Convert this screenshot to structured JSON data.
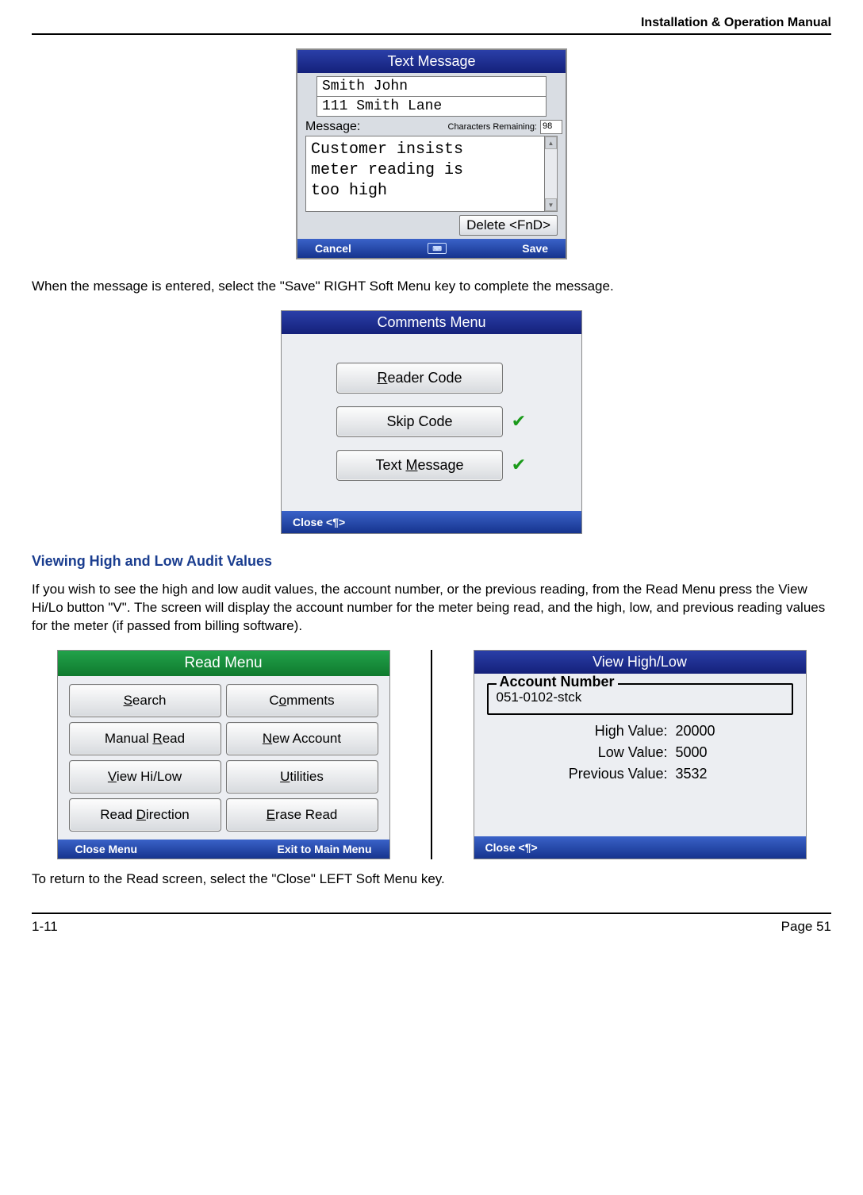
{
  "header": {
    "title": "Installation & Operation Manual"
  },
  "textMessage": {
    "title": "Text Message",
    "name": "Smith John",
    "address": "111 Smith Lane",
    "messageLabel": "Message:",
    "charsLabel": "Characters Remaining:",
    "charsRemaining": "98",
    "body": "Customer insists\nmeter reading is\ntoo high",
    "deleteLabel": "Delete <FnD>",
    "cancelLabel": "Cancel",
    "saveLabel": "Save"
  },
  "para1": "When the message is entered,  select the \"Save\" RIGHT Soft Menu key to complete the message.",
  "commentsMenu": {
    "title": "Comments Menu",
    "readerLabel": "Reader Code",
    "readerMnemonic": "R",
    "skipLabel": "Skip Code",
    "textLabel": "Text Message",
    "textMnemonic": "M",
    "closeLabel": "Close <¶>"
  },
  "section2": {
    "title": "Viewing High and Low Audit Values",
    "para": "If you wish to see the high and low audit values, the account number, or the previous reading, from the Read Menu press the View Hi/Lo button \"V\".  The screen will display the account number for the meter being read, and the high, low, and previous reading values for the meter (if passed from billing software)."
  },
  "readMenu": {
    "title": "Read Menu",
    "buttons": {
      "search": "Search",
      "searchM": "S",
      "comments": "Comments",
      "commentsM": "o",
      "manual": "Manual Read",
      "manualM": "R",
      "newacct": "New Account",
      "newacctM": "N",
      "viewhl": "View Hi/Low",
      "viewhlM": "V",
      "util": "Utilities",
      "utilM": "U",
      "readdir": "Read Direction",
      "readdirM": "D",
      "erase": "Erase Read",
      "eraseM": "E"
    },
    "closeLabel": "Close Menu",
    "exitLabel": "Exit to Main Menu"
  },
  "viewHL": {
    "title": "View High/Low",
    "legend": "Account Number",
    "account": "051-0102-stck",
    "highLabel": "High Value:",
    "highVal": "20000",
    "lowLabel": "Low Value:",
    "lowVal": "5000",
    "prevLabel": "Previous Value:",
    "prevVal": "3532",
    "closeLabel": "Close <¶>"
  },
  "para2": "To return to the Read screen, select the \"Close\" LEFT Soft Menu key.",
  "footer": {
    "left": "1-11",
    "right": "Page 51"
  }
}
